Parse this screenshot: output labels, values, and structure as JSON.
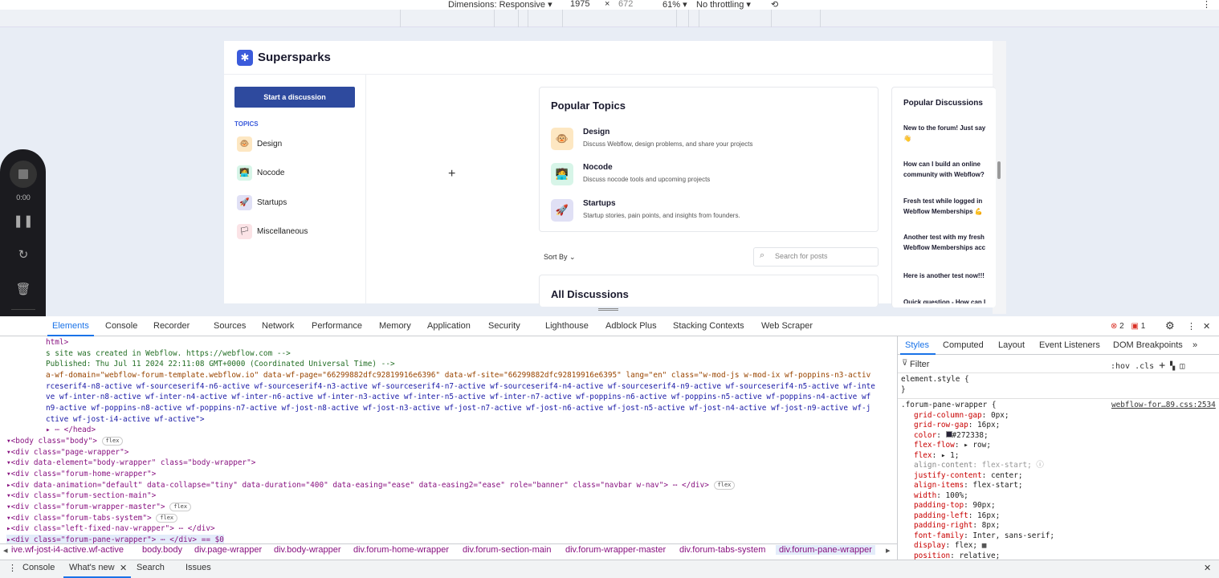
{
  "device_toolbar": {
    "dimensions": "Dimensions: Responsive",
    "width": "1975",
    "times": "×",
    "height": "672",
    "zoom": "61%",
    "throttling": "No throttling"
  },
  "site": {
    "brand": "Supersparks",
    "start_button": "Start a discussion",
    "topics_label": "TOPICS",
    "topics": [
      {
        "label": "Design",
        "icon": "🐵",
        "bg": "#fde7c2"
      },
      {
        "label": "Nocode",
        "icon": "🧑‍💻",
        "bg": "#d7f5e8"
      },
      {
        "label": "Startups",
        "icon": "🚀",
        "bg": "#e0e0f5"
      },
      {
        "label": "Miscellaneous",
        "icon": "🏳",
        "bg": "#fbe3e6"
      }
    ],
    "plus": "+",
    "popular_topics_title": "Popular Topics",
    "popular_topics": [
      {
        "name": "Design",
        "desc": "Discuss Webflow, design problems, and share your projects",
        "icon": "🐵",
        "bg": "#fde7c2"
      },
      {
        "name": "Nocode",
        "desc": "Discuss nocode tools and upcoming projects",
        "icon": "🧑‍💻",
        "bg": "#d7f5e8"
      },
      {
        "name": "Startups",
        "desc": "Startup stories, pain points, and insights from founders.",
        "icon": "🚀",
        "bg": "#e0e0f5"
      }
    ],
    "sort_by": "Sort By",
    "search_placeholder": "Search for posts",
    "all_discussions": "All Discussions",
    "popular_discussions_title": "Popular Discussions",
    "popular_discussions": [
      {
        "l1": "New to the forum! Just say",
        "l2": "👋"
      },
      {
        "l1": "How can I build an online",
        "l2": "community with Webflow?"
      },
      {
        "l1": "Fresh test while logged in",
        "l2": "Webflow Memberships 💪"
      },
      {
        "l1": "Another test with my fresh",
        "l2": "Webflow Memberships acc"
      },
      {
        "l1": "Here is another test now!!!",
        "l2": ""
      },
      {
        "l1": "Quick question - How can I",
        "l2": ""
      }
    ]
  },
  "recorder": {
    "time": "0:00"
  },
  "devtools": {
    "tabs": [
      "Elements",
      "Console",
      "Recorder",
      "Sources",
      "Network",
      "Performance",
      "Memory",
      "Application",
      "Security",
      "Lighthouse",
      "Adblock Plus",
      "Stacking Contexts",
      "Web Scraper"
    ],
    "errors": "2",
    "warnings": "1",
    "code_lines": [
      "html>",
      "s site was created in Webflow. https://webflow.com -->",
      "  Published: Thu Jul 11 2024 22:11:08 GMT+0000 (Coordinated Universal Time) -->",
      "a-wf-domain=\"webflow-forum-template.webflow.io\" data-wf-page=\"66299882dfc92819916e6396\" data-wf-site=\"66299882dfc92819916e6395\" lang=\"en\" class=\"w-mod-js w-mod-ix wf-poppins-n3-activ",
      "rceserif4-n8-active wf-sourceserif4-n6-active wf-sourceserif4-n3-active wf-sourceserif4-n7-active wf-sourceserif4-n4-active wf-sourceserif4-n9-active wf-sourceserif4-n5-active wf-inte",
      "ve wf-inter-n8-active wf-inter-n4-active wf-inter-n6-active wf-inter-n3-active wf-inter-n5-active wf-inter-n7-active wf-poppins-n6-active wf-poppins-n5-active wf-poppins-n4-active wf",
      "n9-active wf-poppins-n8-active wf-poppins-n7-active wf-jost-n8-active wf-jost-n3-active wf-jost-n7-active wf-jost-n6-active wf-jost-n5-active wf-jost-n4-active wf-jost-n9-active wf-j",
      "ctive wf-jost-i4-active wf-active\">",
      "▸ ⋯ </head>",
      "▾<body class=\"body\">",
      "  ▾<div class=\"page-wrapper\">",
      "    ▾<div data-element=\"body-wrapper\" class=\"body-wrapper\">",
      "      ▾<div class=\"forum-home-wrapper\">",
      "        ▸<div data-animation=\"default\" data-collapse=\"tiny\" data-duration=\"400\" data-easing=\"ease\" data-easing2=\"ease\" role=\"banner\" class=\"navbar w-nav\"> ⋯ </div>",
      "        ▾<div class=\"forum-section-main\">",
      "          ▾<div class=\"forum-wrapper-master\">",
      "            ▾<div class=\"forum-tabs-system\">",
      "              ▸<div class=\"left-fixed-nav-wrapper\"> ⋯ </div>",
      "              ▸<div class=\"forum-pane-wrapper\"> ⋯ </div> == $0"
    ],
    "badge_flex": "flex",
    "styles_tabs": [
      "Styles",
      "Computed",
      "Layout",
      "Event Listeners",
      "DOM Breakpoints"
    ],
    "filter": "Filter",
    "hov": ":hov",
    "cls": ".cls",
    "element_style": "element.style {",
    "close_brace": "}",
    "rule_selector": ".forum-pane-wrapper {",
    "rule_source": "webflow-for…89.css:2534",
    "declarations": [
      {
        "p": "grid-column-gap",
        "v": "0px;"
      },
      {
        "p": "grid-row-gap",
        "v": "16px;"
      },
      {
        "p": "color",
        "v": "#272338;"
      },
      {
        "p": "flex-flow",
        "v": "▸ row;"
      },
      {
        "p": "flex",
        "v": "▸ 1;"
      },
      {
        "p": "align-content",
        "v": "flex-start;"
      },
      {
        "p": "justify-content",
        "v": "center;"
      },
      {
        "p": "align-items",
        "v": "flex-start;"
      },
      {
        "p": "width",
        "v": "100%;"
      },
      {
        "p": "padding-top",
        "v": "90px;"
      },
      {
        "p": "padding-left",
        "v": "16px;"
      },
      {
        "p": "padding-right",
        "v": "8px;"
      },
      {
        "p": "font-family",
        "v": "Inter, sans-serif;"
      },
      {
        "p": "display",
        "v": "flex;"
      },
      {
        "p": "position",
        "v": "relative;"
      }
    ],
    "breadcrumbs": [
      "ive.wf-jost-i4-active.wf-active",
      "body.body",
      "div.page-wrapper",
      "div.body-wrapper",
      "div.forum-home-wrapper",
      "div.forum-section-main",
      "div.forum-wrapper-master",
      "div.forum-tabs-system",
      "div.forum-pane-wrapper"
    ],
    "drawer_tabs": [
      "Console",
      "What's new",
      "Search",
      "Issues"
    ]
  }
}
